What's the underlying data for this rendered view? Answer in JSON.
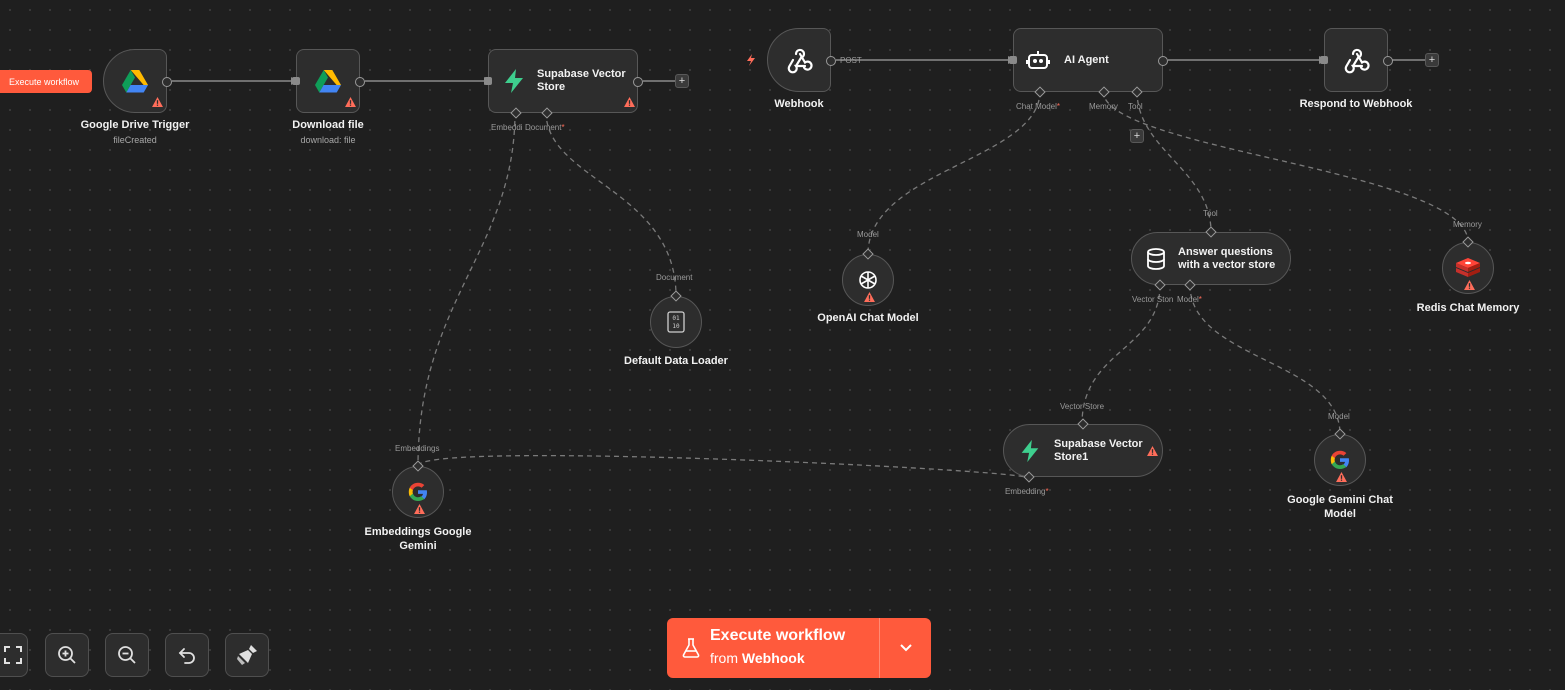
{
  "canvas": {
    "edge_color": "#8c8c8c",
    "dash_color": "#7a7a7a",
    "warning_color": "#ff6d5a"
  },
  "execute_small": {
    "label": "Execute workflow"
  },
  "nodes": {
    "drive_trigger": {
      "title": "Google Drive Trigger",
      "subtitle": "fileCreated",
      "icon": "google-drive-icon"
    },
    "download_file": {
      "title": "Download file",
      "subtitle": "download: file",
      "icon": "google-drive-icon"
    },
    "supabase_store": {
      "title_line1": "Supabase Vector",
      "title_line2": "Store",
      "icon": "supabase-icon"
    },
    "webhook": {
      "title": "Webhook",
      "port_label": "POST",
      "icon": "webhook-icon"
    },
    "ai_agent": {
      "title": "AI Agent",
      "icon": "robot-icon"
    },
    "respond_webhook": {
      "title": "Respond to Webhook",
      "icon": "webhook-icon"
    },
    "openai_model": {
      "title": "OpenAI Chat Model",
      "icon": "openai-icon"
    },
    "answer_questions": {
      "title_line1": "Answer questions",
      "title_line2": "with a vector store",
      "icon": "database-icon"
    },
    "redis_memory": {
      "title": "Redis Chat Memory",
      "icon": "redis-icon"
    },
    "default_loader": {
      "title": "Default Data Loader",
      "icon": "binary-file-icon"
    },
    "supabase_store1": {
      "title_line1": "Supabase Vector",
      "title_line2": "Store1",
      "icon": "supabase-icon"
    },
    "embeddings_gemini": {
      "title_line1": "Embeddings Google",
      "title_line2": "Gemini",
      "icon": "google-icon"
    },
    "gemini_model": {
      "title_line1": "Google Gemini Chat",
      "title_line2": "Model",
      "icon": "google-icon"
    }
  },
  "ports": {
    "embeddi": "Embeddi",
    "document": "Document",
    "chat_model": "Chat Model",
    "memory": "Memory",
    "tool": "Tool",
    "model": "Model",
    "vector_ston": "Vector Ston",
    "vector_store": "Vector Store",
    "embeddings": "Embeddings",
    "embedding": "Embedding",
    "required_mark": "*"
  },
  "toolbar": {
    "buttons": [
      "fit-view-icon",
      "zoom-in-icon",
      "zoom-out-icon",
      "undo-icon",
      "clear-broom-icon"
    ]
  },
  "execute_main": {
    "line1": "Execute workflow",
    "line2_prefix": "from",
    "line2_target": "Webhook",
    "icon": "flask-icon",
    "dropdown_icon": "chevron-down-icon",
    "color": "#ff5a3c"
  }
}
